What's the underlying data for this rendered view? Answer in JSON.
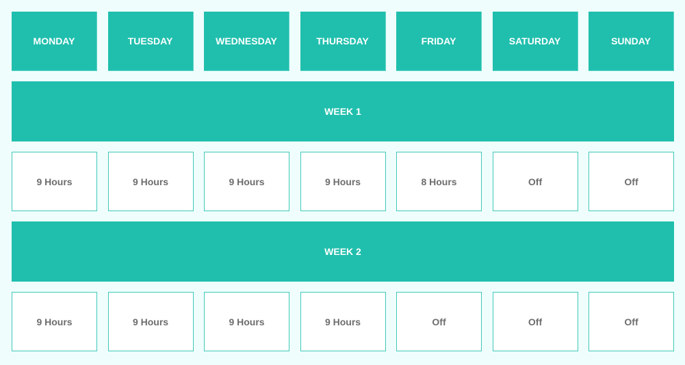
{
  "days": [
    "MONDAY",
    "TUESDAY",
    "WEDNESDAY",
    "THURSDAY",
    "FRIDAY",
    "SATURDAY",
    "SUNDAY"
  ],
  "weeks": [
    {
      "label": "WEEK 1",
      "hours": [
        "9 Hours",
        "9 Hours",
        "9 Hours",
        "9 Hours",
        "8 Hours",
        "Off",
        "Off"
      ]
    },
    {
      "label": "WEEK 2",
      "hours": [
        "9 Hours",
        "9 Hours",
        "9 Hours",
        "9 Hours",
        "Off",
        "Off",
        "Off"
      ]
    }
  ],
  "colors": {
    "accent": "#20bfad",
    "background": "#effefd",
    "cell_text": "#6d6d6d"
  }
}
